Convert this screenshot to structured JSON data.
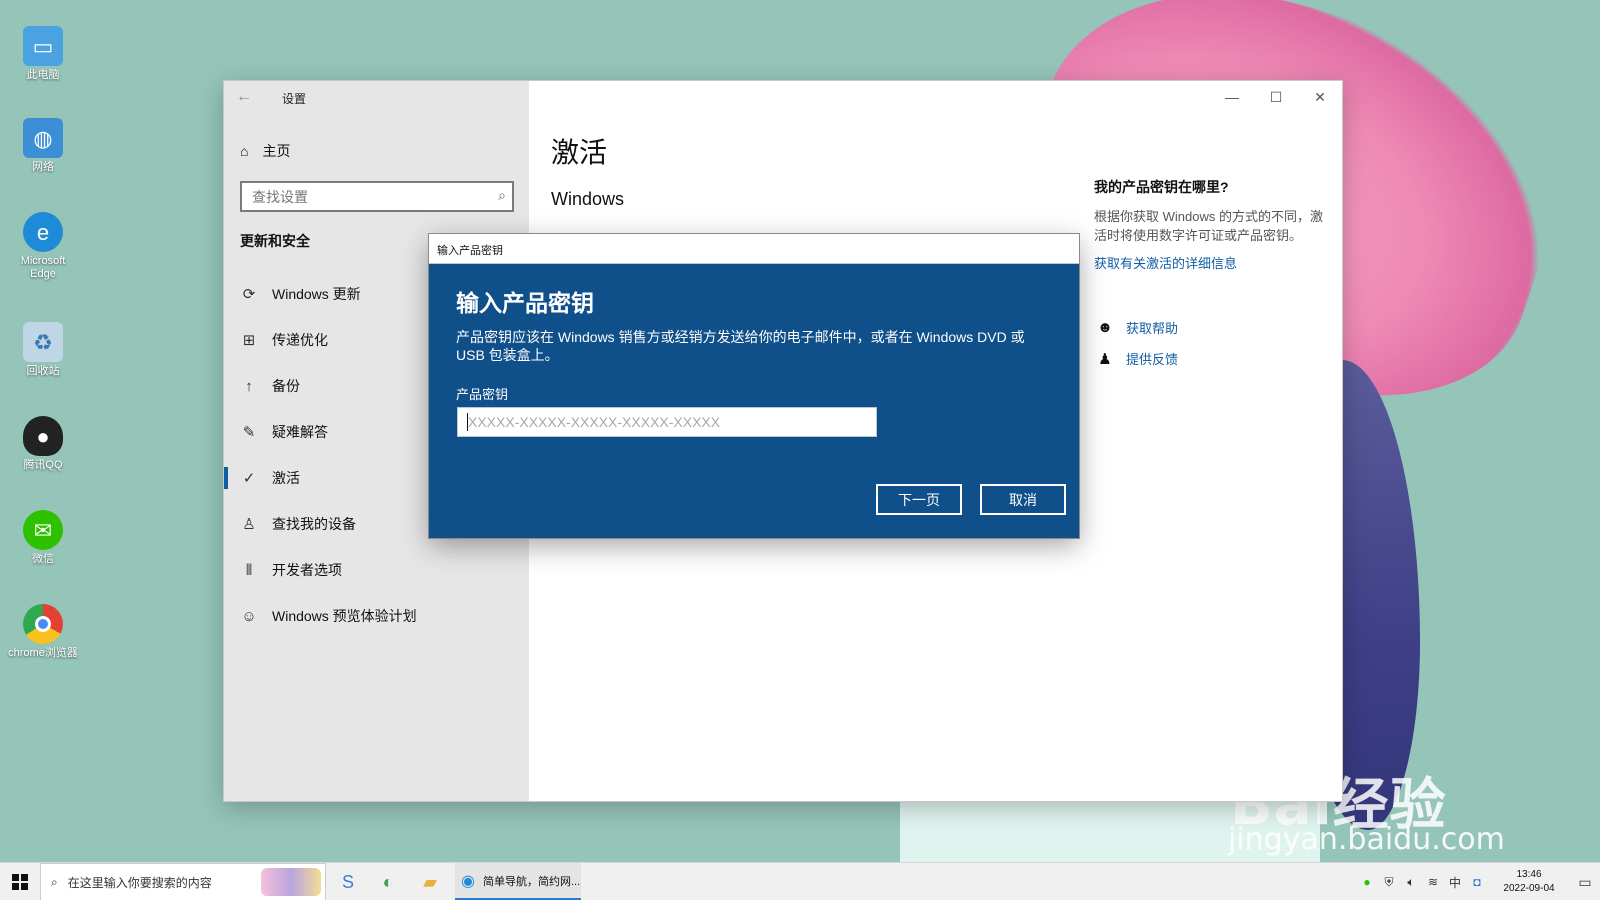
{
  "desktop": {
    "icons": [
      {
        "label": "此电脑",
        "icon": "computer-icon",
        "color": "#4aa3e0"
      },
      {
        "label": "网络",
        "icon": "network-icon",
        "color": "#3c8fd6"
      },
      {
        "label": "Microsoft Edge",
        "icon": "edge-icon",
        "color": "#1e8ad8"
      },
      {
        "label": "回收站",
        "icon": "recycle-bin-icon",
        "color": "#bfd6e6"
      },
      {
        "label": "腾讯QQ",
        "icon": "qq-icon",
        "color": "#222222"
      },
      {
        "label": "微信",
        "icon": "wechat-icon",
        "color": "#2dc100"
      },
      {
        "label": "chrome浏览器",
        "icon": "chrome-icon",
        "color": "#e34133"
      }
    ],
    "watermark": {
      "line1": "Bai经验",
      "line2": "jingyan.baidu.com"
    }
  },
  "settings": {
    "title": "设置",
    "home": "主页",
    "search_placeholder": "查找设置",
    "section": "更新和安全",
    "nav": [
      {
        "label": "Windows 更新",
        "icon": "refresh-icon"
      },
      {
        "label": "传递优化",
        "icon": "delivery-icon"
      },
      {
        "label": "备份",
        "icon": "backup-icon"
      },
      {
        "label": "疑难解答",
        "icon": "wrench-icon"
      },
      {
        "label": "激活",
        "icon": "check-circle-icon",
        "active": true
      },
      {
        "label": "查找我的设备",
        "icon": "find-device-icon"
      },
      {
        "label": "开发者选项",
        "icon": "developer-icon"
      },
      {
        "label": "Windows 预览体验计划",
        "icon": "insider-icon"
      }
    ],
    "page_title": "激活",
    "sub_heading": "Windows",
    "aside": {
      "question": "我的产品密钥在哪里?",
      "body": "根据你获取 Windows 的方式的不同，激活时将使用数字许可证或产品密钥。",
      "link": "获取有关激活的详细信息",
      "help": "获取帮助",
      "feedback": "提供反馈"
    }
  },
  "dialog": {
    "titlebar": "输入产品密钥",
    "heading": "输入产品密钥",
    "description": "产品密钥应该在 Windows 销售方或经销方发送给你的电子邮件中，或者在 Windows DVD 或 USB 包装盒上。",
    "field_label": "产品密钥",
    "key_placeholder": "XXXXX-XXXXX-XXXXX-XXXXX-XXXXX",
    "key_value": "",
    "next_label": "下一页",
    "cancel_label": "取消"
  },
  "taskbar": {
    "search_placeholder": "在这里输入你要搜索的内容",
    "active_task": "简单导航，简约网...",
    "time": "13:46",
    "date": "2022-09-04"
  },
  "colors": {
    "accent": "#0f5ea5",
    "dialog_bg": "#0f4f8a",
    "desktop_bg": "#95c4b8"
  }
}
